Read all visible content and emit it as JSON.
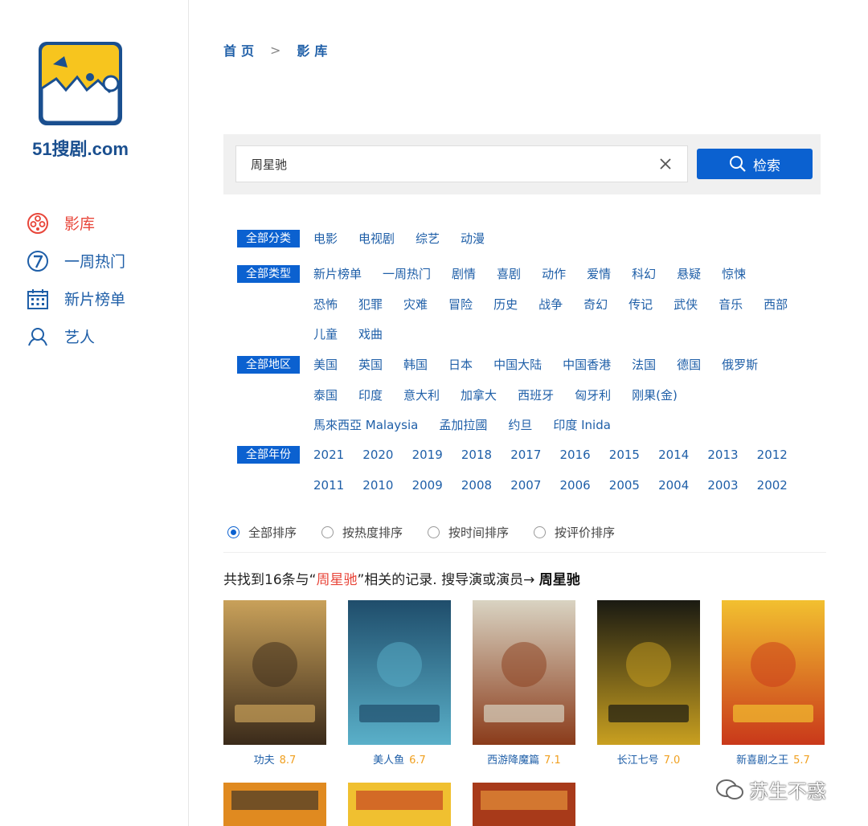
{
  "brand": {
    "logo_text": "51搜剧.com"
  },
  "nav": [
    {
      "label": "影库",
      "icon": "film-reel-icon",
      "active": true
    },
    {
      "label": "一周热门",
      "icon": "seven-icon",
      "active": false
    },
    {
      "label": "新片榜单",
      "icon": "calendar-icon",
      "active": false
    },
    {
      "label": "艺人",
      "icon": "person-icon",
      "active": false
    }
  ],
  "breadcrumb": {
    "home": "首页",
    "sep": ">",
    "current": "影库"
  },
  "search": {
    "value": "周星驰",
    "button": "检索"
  },
  "filters": {
    "category": {
      "tag": "全部分类",
      "options": [
        "电影",
        "电视剧",
        "综艺",
        "动漫"
      ]
    },
    "genre": {
      "tag": "全部类型",
      "options": [
        "新片榜单",
        "一周热门",
        "剧情",
        "喜剧",
        "动作",
        "爱情",
        "科幻",
        "悬疑",
        "惊悚",
        "恐怖",
        "犯罪",
        "灾难",
        "冒险",
        "历史",
        "战争",
        "奇幻",
        "传记",
        "武侠",
        "音乐",
        "西部",
        "儿童",
        "戏曲"
      ]
    },
    "region": {
      "tag": "全部地区",
      "options": [
        "美国",
        "英国",
        "韩国",
        "日本",
        "中国大陆",
        "中国香港",
        "法国",
        "德国",
        "俄罗斯",
        "泰国",
        "印度",
        "意大利",
        "加拿大",
        "西班牙",
        "匈牙利",
        "刚果(金)",
        "馬來西亞 Malaysia",
        "孟加拉國",
        "约旦",
        "印度 Inida"
      ]
    },
    "year": {
      "tag": "全部年份",
      "options": [
        "2021",
        "2020",
        "2019",
        "2018",
        "2017",
        "2016",
        "2015",
        "2014",
        "2013",
        "2012",
        "2011",
        "2010",
        "2009",
        "2008",
        "2007",
        "2006",
        "2005",
        "2004",
        "2003",
        "2002"
      ]
    }
  },
  "sort": [
    {
      "label": "全部排序",
      "checked": true
    },
    {
      "label": "按热度排序",
      "checked": false
    },
    {
      "label": "按时间排序",
      "checked": false
    },
    {
      "label": "按评价排序",
      "checked": false
    }
  ],
  "result": {
    "prefix": "共找到16条与“",
    "keyword": "周星驰",
    "suffix": "”相关的记录. 搜导演或演员→ ",
    "person": "周星驰"
  },
  "movies": [
    {
      "title": "功夫",
      "score": "8.7",
      "colors": [
        "#c9a15a",
        "#3a2a1a"
      ]
    },
    {
      "title": "美人鱼",
      "score": "6.7",
      "colors": [
        "#1f4d6b",
        "#5ab0c9"
      ]
    },
    {
      "title": "西游降魔篇",
      "score": "7.1",
      "colors": [
        "#d9d3c2",
        "#8a3b1a"
      ]
    },
    {
      "title": "长江七号",
      "score": "7.0",
      "colors": [
        "#1a1a12",
        "#c9a020"
      ]
    },
    {
      "title": "新喜剧之王",
      "score": "5.7",
      "colors": [
        "#f2c030",
        "#c9381a"
      ]
    }
  ],
  "movies_row2": [
    {
      "colors": [
        "#e08a20",
        "#2a2a2a"
      ]
    },
    {
      "colors": [
        "#f0c030",
        "#c03020"
      ]
    },
    {
      "colors": [
        "#a83a1a",
        "#f0a040"
      ]
    }
  ],
  "watermark": {
    "text": "苏生不惑"
  },
  "colors": {
    "accent": "#0b61d0",
    "link": "#1f5fa8",
    "highlight": "#e8463a",
    "score": "#f0a020"
  }
}
